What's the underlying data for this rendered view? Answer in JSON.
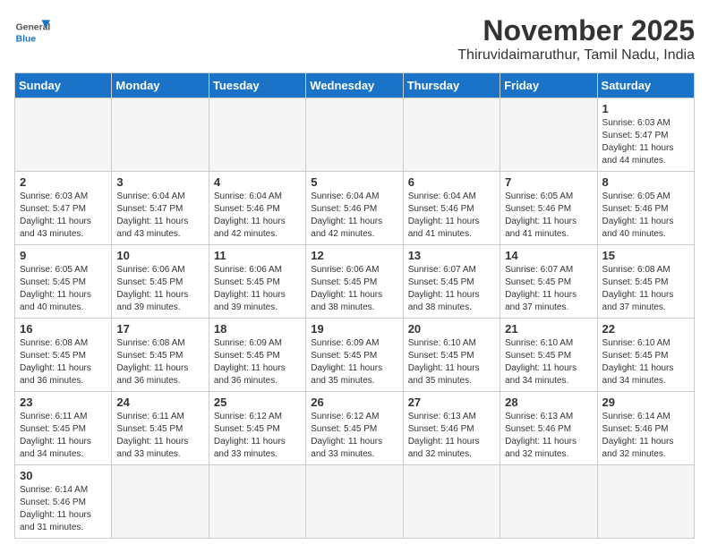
{
  "header": {
    "logo_text_general": "General",
    "logo_text_blue": "Blue",
    "month_title": "November 2025",
    "subtitle": "Thiruvidaimaruthur, Tamil Nadu, India"
  },
  "weekdays": [
    "Sunday",
    "Monday",
    "Tuesday",
    "Wednesday",
    "Thursday",
    "Friday",
    "Saturday"
  ],
  "weeks": [
    [
      {
        "day": "",
        "empty": true
      },
      {
        "day": "",
        "empty": true
      },
      {
        "day": "",
        "empty": true
      },
      {
        "day": "",
        "empty": true
      },
      {
        "day": "",
        "empty": true
      },
      {
        "day": "",
        "empty": true
      },
      {
        "day": "1",
        "sunrise": "Sunrise: 6:03 AM",
        "sunset": "Sunset: 5:47 PM",
        "daylight": "Daylight: 11 hours and 44 minutes."
      }
    ],
    [
      {
        "day": "2",
        "sunrise": "Sunrise: 6:03 AM",
        "sunset": "Sunset: 5:47 PM",
        "daylight": "Daylight: 11 hours and 43 minutes."
      },
      {
        "day": "3",
        "sunrise": "Sunrise: 6:04 AM",
        "sunset": "Sunset: 5:47 PM",
        "daylight": "Daylight: 11 hours and 43 minutes."
      },
      {
        "day": "4",
        "sunrise": "Sunrise: 6:04 AM",
        "sunset": "Sunset: 5:46 PM",
        "daylight": "Daylight: 11 hours and 42 minutes."
      },
      {
        "day": "5",
        "sunrise": "Sunrise: 6:04 AM",
        "sunset": "Sunset: 5:46 PM",
        "daylight": "Daylight: 11 hours and 42 minutes."
      },
      {
        "day": "6",
        "sunrise": "Sunrise: 6:04 AM",
        "sunset": "Sunset: 5:46 PM",
        "daylight": "Daylight: 11 hours and 41 minutes."
      },
      {
        "day": "7",
        "sunrise": "Sunrise: 6:05 AM",
        "sunset": "Sunset: 5:46 PM",
        "daylight": "Daylight: 11 hours and 41 minutes."
      },
      {
        "day": "8",
        "sunrise": "Sunrise: 6:05 AM",
        "sunset": "Sunset: 5:46 PM",
        "daylight": "Daylight: 11 hours and 40 minutes."
      }
    ],
    [
      {
        "day": "9",
        "sunrise": "Sunrise: 6:05 AM",
        "sunset": "Sunset: 5:45 PM",
        "daylight": "Daylight: 11 hours and 40 minutes."
      },
      {
        "day": "10",
        "sunrise": "Sunrise: 6:06 AM",
        "sunset": "Sunset: 5:45 PM",
        "daylight": "Daylight: 11 hours and 39 minutes."
      },
      {
        "day": "11",
        "sunrise": "Sunrise: 6:06 AM",
        "sunset": "Sunset: 5:45 PM",
        "daylight": "Daylight: 11 hours and 39 minutes."
      },
      {
        "day": "12",
        "sunrise": "Sunrise: 6:06 AM",
        "sunset": "Sunset: 5:45 PM",
        "daylight": "Daylight: 11 hours and 38 minutes."
      },
      {
        "day": "13",
        "sunrise": "Sunrise: 6:07 AM",
        "sunset": "Sunset: 5:45 PM",
        "daylight": "Daylight: 11 hours and 38 minutes."
      },
      {
        "day": "14",
        "sunrise": "Sunrise: 6:07 AM",
        "sunset": "Sunset: 5:45 PM",
        "daylight": "Daylight: 11 hours and 37 minutes."
      },
      {
        "day": "15",
        "sunrise": "Sunrise: 6:08 AM",
        "sunset": "Sunset: 5:45 PM",
        "daylight": "Daylight: 11 hours and 37 minutes."
      }
    ],
    [
      {
        "day": "16",
        "sunrise": "Sunrise: 6:08 AM",
        "sunset": "Sunset: 5:45 PM",
        "daylight": "Daylight: 11 hours and 36 minutes."
      },
      {
        "day": "17",
        "sunrise": "Sunrise: 6:08 AM",
        "sunset": "Sunset: 5:45 PM",
        "daylight": "Daylight: 11 hours and 36 minutes."
      },
      {
        "day": "18",
        "sunrise": "Sunrise: 6:09 AM",
        "sunset": "Sunset: 5:45 PM",
        "daylight": "Daylight: 11 hours and 36 minutes."
      },
      {
        "day": "19",
        "sunrise": "Sunrise: 6:09 AM",
        "sunset": "Sunset: 5:45 PM",
        "daylight": "Daylight: 11 hours and 35 minutes."
      },
      {
        "day": "20",
        "sunrise": "Sunrise: 6:10 AM",
        "sunset": "Sunset: 5:45 PM",
        "daylight": "Daylight: 11 hours and 35 minutes."
      },
      {
        "day": "21",
        "sunrise": "Sunrise: 6:10 AM",
        "sunset": "Sunset: 5:45 PM",
        "daylight": "Daylight: 11 hours and 34 minutes."
      },
      {
        "day": "22",
        "sunrise": "Sunrise: 6:10 AM",
        "sunset": "Sunset: 5:45 PM",
        "daylight": "Daylight: 11 hours and 34 minutes."
      }
    ],
    [
      {
        "day": "23",
        "sunrise": "Sunrise: 6:11 AM",
        "sunset": "Sunset: 5:45 PM",
        "daylight": "Daylight: 11 hours and 34 minutes."
      },
      {
        "day": "24",
        "sunrise": "Sunrise: 6:11 AM",
        "sunset": "Sunset: 5:45 PM",
        "daylight": "Daylight: 11 hours and 33 minutes."
      },
      {
        "day": "25",
        "sunrise": "Sunrise: 6:12 AM",
        "sunset": "Sunset: 5:45 PM",
        "daylight": "Daylight: 11 hours and 33 minutes."
      },
      {
        "day": "26",
        "sunrise": "Sunrise: 6:12 AM",
        "sunset": "Sunset: 5:45 PM",
        "daylight": "Daylight: 11 hours and 33 minutes."
      },
      {
        "day": "27",
        "sunrise": "Sunrise: 6:13 AM",
        "sunset": "Sunset: 5:46 PM",
        "daylight": "Daylight: 11 hours and 32 minutes."
      },
      {
        "day": "28",
        "sunrise": "Sunrise: 6:13 AM",
        "sunset": "Sunset: 5:46 PM",
        "daylight": "Daylight: 11 hours and 32 minutes."
      },
      {
        "day": "29",
        "sunrise": "Sunrise: 6:14 AM",
        "sunset": "Sunset: 5:46 PM",
        "daylight": "Daylight: 11 hours and 32 minutes."
      }
    ],
    [
      {
        "day": "30",
        "sunrise": "Sunrise: 6:14 AM",
        "sunset": "Sunset: 5:46 PM",
        "daylight": "Daylight: 11 hours and 31 minutes."
      },
      {
        "day": "",
        "empty": true
      },
      {
        "day": "",
        "empty": true
      },
      {
        "day": "",
        "empty": true
      },
      {
        "day": "",
        "empty": true
      },
      {
        "day": "",
        "empty": true
      },
      {
        "day": "",
        "empty": true
      }
    ]
  ]
}
